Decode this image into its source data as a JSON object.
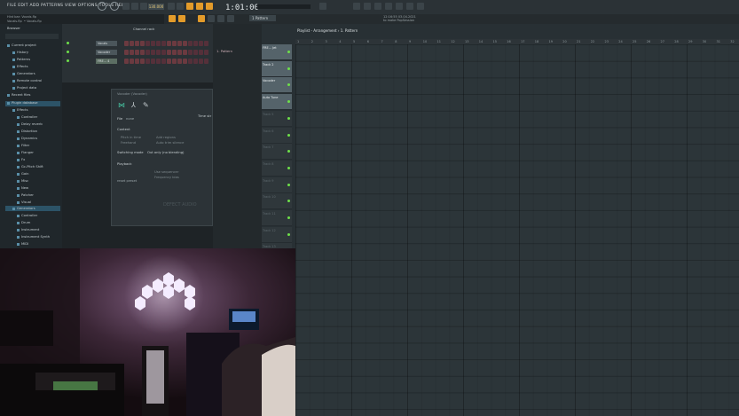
{
  "menu": "FILE  EDIT  ADD  PATTERNS  VIEW  OPTIONS  TOOLS  HELP",
  "hint": [
    "Hint bar: Vocals.flp",
    "Vocals.flp  • Vocals.flp"
  ],
  "transport": {
    "bpm": "130.000",
    "time": "1:01:00",
    "pattern": "1 Pattern"
  },
  "cpu": [
    "12:16:55  03.04.2021",
    "to make PopSession"
  ],
  "browser": {
    "title": "Browser",
    "items": [
      {
        "label": "Current project"
      },
      {
        "label": "History"
      },
      {
        "label": "Patterns"
      },
      {
        "label": "Effects"
      },
      {
        "label": "Generators"
      },
      {
        "label": "Remote control"
      },
      {
        "label": "Project data"
      },
      {
        "label": "Recent files"
      },
      {
        "label": "Plugin database"
      },
      {
        "label": "Effects"
      },
      {
        "label": "Controller"
      },
      {
        "label": "Delay reverb"
      },
      {
        "label": "Distortion"
      },
      {
        "label": "Dynamics"
      },
      {
        "label": "Filter"
      },
      {
        "label": "Flanger"
      },
      {
        "label": "Fx"
      },
      {
        "label": "Gc-Pitch Shift"
      },
      {
        "label": "Gain"
      },
      {
        "label": "Misc"
      },
      {
        "label": "New"
      },
      {
        "label": "Patcher"
      },
      {
        "label": "Visual"
      },
      {
        "label": "Generators"
      },
      {
        "label": "Controller"
      },
      {
        "label": "Drum"
      },
      {
        "label": "Instrument"
      },
      {
        "label": "Instrument Synth"
      },
      {
        "label": "MIDI"
      },
      {
        "label": "Misc"
      }
    ]
  },
  "channel_rack": {
    "title": "Channel rack",
    "channels": [
      "Vocals",
      "Vocoder",
      "FRE... 4"
    ]
  },
  "plugin_panel": {
    "title": "Vocoder (Vocoder)",
    "file_label": "File",
    "file_value": "none",
    "content_label": "Content",
    "options": [
      "Pitch in time",
      "Freehand",
      "Add regions",
      "Auto trim silence"
    ],
    "switching_label": "Switching mode",
    "switching_value": "Out only (no blending)",
    "playback_label": "Playback",
    "playback_options": [
      "Use sequencer",
      "Frequency bias"
    ],
    "reset_label": "reset preset",
    "time_label": "Time str",
    "brand": "DEFECT AUDIO"
  },
  "picker": {
    "label": "1. Pattern"
  },
  "playlist": {
    "title": "Playlist - Arrangement › 1. Pattern",
    "ruler": [
      "1",
      "2",
      "3",
      "4",
      "5",
      "6",
      "7",
      "8",
      "9",
      "10",
      "11",
      "12",
      "13",
      "14",
      "15",
      "16",
      "17",
      "18",
      "19",
      "20",
      "21",
      "22",
      "23",
      "24",
      "25",
      "26",
      "27",
      "28",
      "29",
      "30",
      "31",
      "32"
    ],
    "tracks": [
      {
        "label": "FRE... Jet",
        "active": true
      },
      {
        "label": "Track 2",
        "active": true
      },
      {
        "label": "Vocoder",
        "active": true
      },
      {
        "label": "Auto Tune",
        "active": true
      },
      {
        "label": "Track 5",
        "active": false
      },
      {
        "label": "Track 6",
        "active": false
      },
      {
        "label": "Track 7",
        "active": false
      },
      {
        "label": "Track 8",
        "active": false
      },
      {
        "label": "Track 9",
        "active": false
      },
      {
        "label": "Track 10",
        "active": false
      },
      {
        "label": "Track 11",
        "active": false
      },
      {
        "label": "Track 12",
        "active": false
      },
      {
        "label": "Track 13",
        "active": false
      }
    ]
  },
  "colors": {
    "accent": "#e39b2a",
    "led": "#6ee04a",
    "grid": "#2c3539",
    "highlight": "#2c5367"
  }
}
